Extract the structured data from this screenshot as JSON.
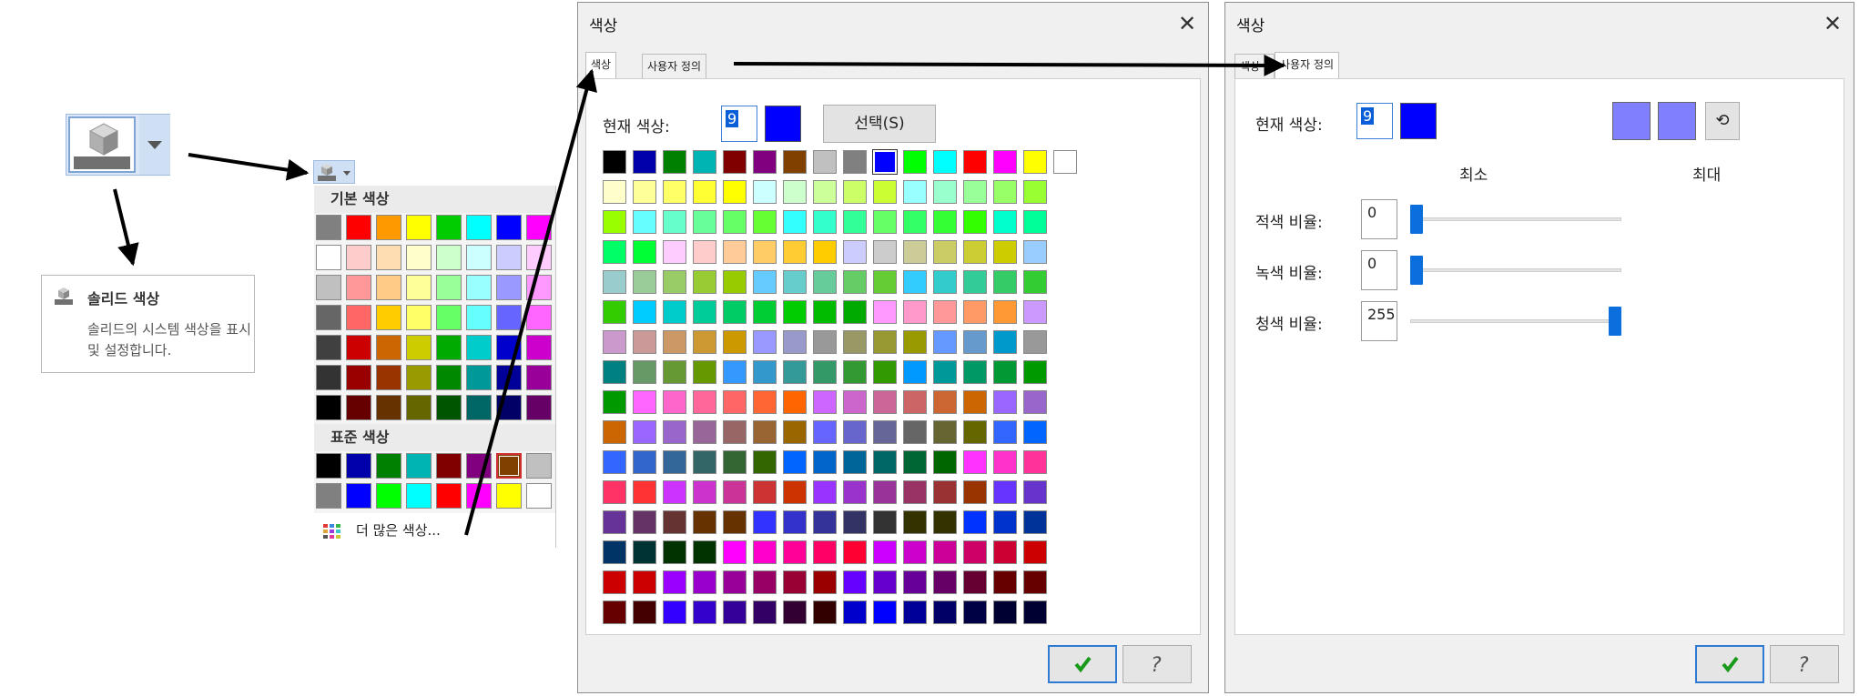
{
  "tooltip": {
    "title": "솔리드 색상",
    "description": "솔리드의 시스템 색상을 표시 및 설정합니다."
  },
  "palette": {
    "basic_header": "기본 색상",
    "standard_header": "표준 색상",
    "more_label": "더 많은 색상...",
    "basic_rows": [
      [
        "#808080",
        "#ff0000",
        "#ff9900",
        "#ffff00",
        "#00cc00",
        "#00ffff",
        "#0000ff",
        "#ff00ff"
      ],
      [
        "#ffffff",
        "#ffcccc",
        "#ffddb3",
        "#ffffcc",
        "#ccffcc",
        "#ccffff",
        "#ccccff",
        "#ffccff"
      ],
      [
        "#c0c0c0",
        "#ff9999",
        "#ffcc88",
        "#ffff99",
        "#99ff99",
        "#99ffff",
        "#9999ff",
        "#ff99ff"
      ],
      [
        "#666666",
        "#ff6666",
        "#ffcc00",
        "#ffff66",
        "#66ff66",
        "#66ffff",
        "#6666ff",
        "#ff66ff"
      ],
      [
        "#404040",
        "#cc0000",
        "#cc6600",
        "#cccc00",
        "#00aa00",
        "#00cccc",
        "#0000cc",
        "#cc00cc"
      ],
      [
        "#333333",
        "#990000",
        "#993300",
        "#999900",
        "#008800",
        "#009999",
        "#000099",
        "#990099"
      ],
      [
        "#000000",
        "#660000",
        "#663300",
        "#666600",
        "#005500",
        "#006666",
        "#000066",
        "#660066"
      ]
    ],
    "standard_rows": [
      [
        "#000000",
        "#0000aa",
        "#008000",
        "#00b4b4",
        "#800000",
        "#800080",
        "#804000",
        "#c0c0c0"
      ],
      [
        "#808080",
        "#0000ff",
        "#00ff00",
        "#00ffff",
        "#ff0000",
        "#ff00ff",
        "#ffff00",
        "#ffffff"
      ]
    ],
    "selected": {
      "row": 0,
      "col": 6
    }
  },
  "dialog1": {
    "title": "색상",
    "tabs": [
      "색상",
      "사용자 정의"
    ],
    "current_label": "현재 색상:",
    "current_value": "9",
    "current_color": "#0000ff",
    "select_button": "선택(S)",
    "grid_rows": [
      [
        "#000000",
        "#0000aa",
        "#008000",
        "#00b4b4",
        "#800000",
        "#800080",
        "#804000",
        "#c0c0c0",
        "#808080",
        "#0000ff",
        "#00ff00",
        "#00ffff",
        "#ff0000",
        "#ff00ff",
        "#ffff00",
        "#ffffff"
      ],
      [
        "#ffffcc",
        "#ffff99",
        "#ffff66",
        "#ffff33",
        "#ffff00",
        "#ccffff",
        "#ccffcc",
        "#ccff99",
        "#ccff66",
        "#ccff33",
        "#99ffff",
        "#99ffcc",
        "#99ff99",
        "#99ff66",
        "#99ff33"
      ],
      [
        "#99ff00",
        "#66ffff",
        "#66ffcc",
        "#66ff99",
        "#66ff66",
        "#66ff33",
        "#33ffff",
        "#33ffcc",
        "#33ff99",
        "#66ff66",
        "#33ff66",
        "#33ff33",
        "#33ff00",
        "#00ffcc",
        "#00ff99"
      ],
      [
        "#00ff66",
        "#00ff33",
        "#ffccff",
        "#ffcccc",
        "#ffcc99",
        "#ffcc66",
        "#ffcc33",
        "#ffcc00",
        "#ccccff",
        "#cccccc",
        "#cccc99",
        "#cccc66",
        "#cccc33",
        "#cccc00",
        "#99ccff"
      ],
      [
        "#99cccc",
        "#99cc99",
        "#99cc66",
        "#99cc33",
        "#99cc00",
        "#66ccff",
        "#66cccc",
        "#66cc99",
        "#66cc66",
        "#66cc33",
        "#33ccff",
        "#33cccc",
        "#33cc99",
        "#33cc66",
        "#33cc33"
      ],
      [
        "#33cc00",
        "#00ccff",
        "#00cccc",
        "#00cc99",
        "#00cc66",
        "#00cc33",
        "#00cc00",
        "#00bb00",
        "#00aa00",
        "#ff99ff",
        "#ff99cc",
        "#ff9999",
        "#ff9966",
        "#ff9933",
        "#cc99ff"
      ],
      [
        "#cc99cc",
        "#cc9999",
        "#cc9966",
        "#cc9933",
        "#cc9900",
        "#9999ff",
        "#9999cc",
        "#999999",
        "#999966",
        "#999933",
        "#999900",
        "#6699ff",
        "#6699cc",
        "#0099cc",
        "#999999"
      ],
      [
        "#008080",
        "#669966",
        "#669933",
        "#669900",
        "#3399ff",
        "#3399cc",
        "#339999",
        "#339966",
        "#339933",
        "#339900",
        "#0099ff",
        "#009999",
        "#009966",
        "#009933",
        "#009900"
      ],
      [
        "#009900",
        "#ff66ff",
        "#ff66cc",
        "#ff6699",
        "#ff6666",
        "#ff6633",
        "#ff6600",
        "#cc66ff",
        "#cc66cc",
        "#cc6699",
        "#cc6666",
        "#cc6633",
        "#cc6600",
        "#9966ff",
        "#9966cc"
      ],
      [
        "#cc6600",
        "#9966ff",
        "#9966cc",
        "#996699",
        "#996666",
        "#996633",
        "#996600",
        "#6666ff",
        "#6666cc",
        "#666699",
        "#666666",
        "#666633",
        "#666600",
        "#3366ff",
        "#0066ff"
      ],
      [
        "#3366ff",
        "#3366cc",
        "#336699",
        "#336666",
        "#336633",
        "#336600",
        "#0066ff",
        "#0066cc",
        "#006699",
        "#006666",
        "#006633",
        "#006600",
        "#ff33ff",
        "#ff33cc",
        "#ff3399"
      ],
      [
        "#ff3366",
        "#ff3333",
        "#cc33ff",
        "#cc33cc",
        "#cc3399",
        "#cc3333",
        "#cc3300",
        "#9933ff",
        "#9933cc",
        "#993399",
        "#993366",
        "#993333",
        "#993300",
        "#6633ff",
        "#6633cc"
      ],
      [
        "#663399",
        "#663366",
        "#663333",
        "#663300",
        "#663300",
        "#3333ff",
        "#3333cc",
        "#333399",
        "#333366",
        "#333333",
        "#333300",
        "#333300",
        "#0033ff",
        "#0033cc",
        "#003399"
      ],
      [
        "#003366",
        "#003333",
        "#003300",
        "#003300",
        "#ff00ff",
        "#ff00cc",
        "#ff0099",
        "#ff0066",
        "#ff0033",
        "#cc00ff",
        "#cc00cc",
        "#cc0099",
        "#cc0066",
        "#cc0033",
        "#cc0000"
      ],
      [
        "#cc0000",
        "#cc0000",
        "#9900ff",
        "#9900cc",
        "#990099",
        "#990066",
        "#990033",
        "#990000",
        "#6600ff",
        "#6600cc",
        "#660099",
        "#660066",
        "#660033",
        "#660000",
        "#660000"
      ],
      [
        "#660000",
        "#440000",
        "#3300ff",
        "#3300cc",
        "#330099",
        "#330066",
        "#330033",
        "#330000",
        "#0000cc",
        "#0000ff",
        "#000099",
        "#000066",
        "#000044",
        "#000033",
        "#000033"
      ]
    ]
  },
  "dialog2": {
    "title": "색상",
    "tabs": [
      "색상",
      "사용자 정의"
    ],
    "current_label": "현재 색상:",
    "current_value": "9",
    "current_color": "#0000ff",
    "preview_colors": [
      "#8080ff",
      "#8080ff"
    ],
    "min_label": "최소",
    "max_label": "최대",
    "sliders": [
      {
        "label": "적색 비율:",
        "value": "0",
        "level": 0
      },
      {
        "label": "녹색 비율:",
        "value": "0",
        "level": 0
      },
      {
        "label": "청색 비율:",
        "value": "255",
        "level": 1
      }
    ]
  }
}
